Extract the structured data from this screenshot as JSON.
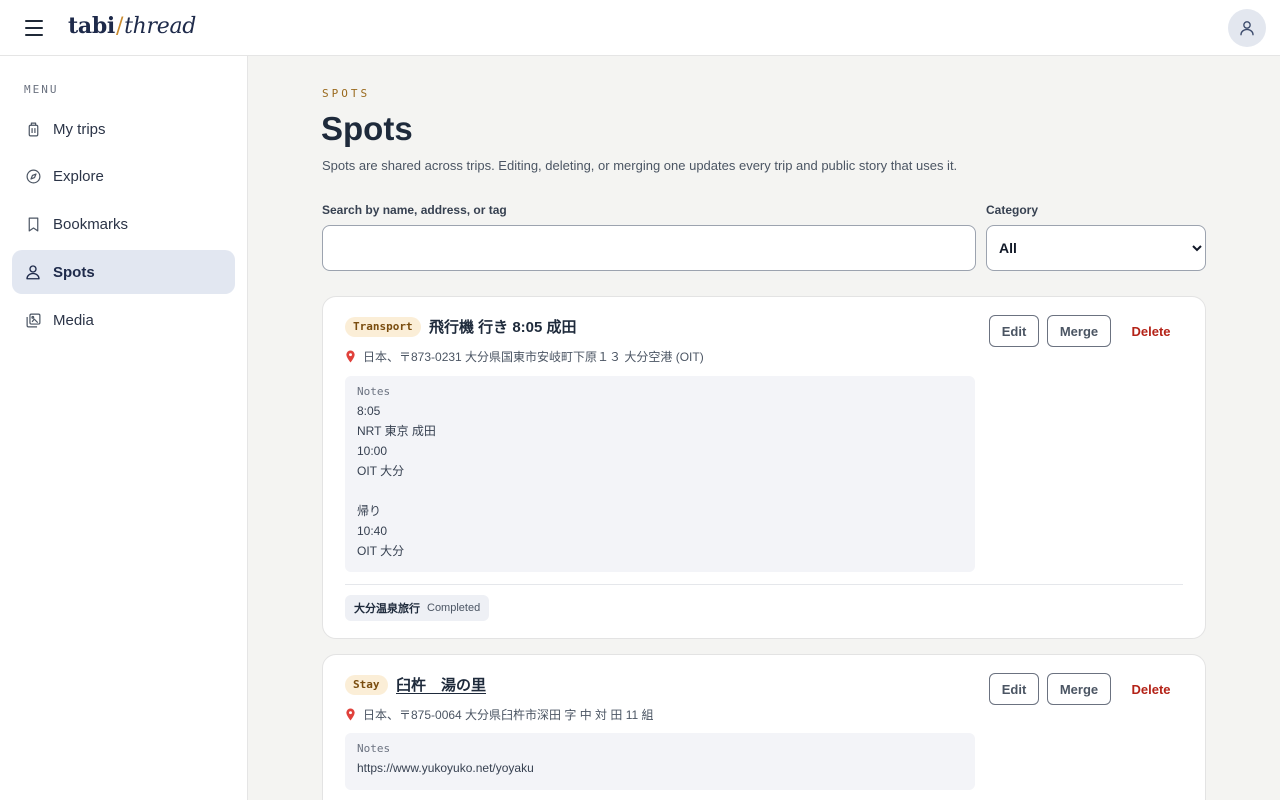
{
  "header": {
    "brand_part1": "tabi",
    "brand_slash": "/",
    "brand_part2": "thread"
  },
  "sidebar": {
    "menu_label": "MENU",
    "items": [
      {
        "label": "My trips",
        "icon": "luggage-icon",
        "active": false
      },
      {
        "label": "Explore",
        "icon": "compass-icon",
        "active": false
      },
      {
        "label": "Bookmarks",
        "icon": "bookmark-icon",
        "active": false
      },
      {
        "label": "Spots",
        "icon": "user-pin-icon",
        "active": true
      },
      {
        "label": "Media",
        "icon": "gallery-icon",
        "active": false
      }
    ]
  },
  "page": {
    "eyebrow": "SPOTS",
    "title": "Spots",
    "description": "Spots are shared across trips. Editing, deleting, or merging one updates every trip and public story that uses it."
  },
  "filters": {
    "search_label": "Search by name, address, or tag",
    "search_value": "",
    "category_label": "Category",
    "category_value": "All"
  },
  "actions": {
    "edit": "Edit",
    "merge": "Merge",
    "delete": "Delete"
  },
  "spots": [
    {
      "category": "Transport",
      "name": "飛行機 行き 8:05 成田",
      "address": "日本、〒873-0231 大分県国東市安岐町下原１３ 大分空港 (OIT)",
      "notes_label": "Notes",
      "notes": "8:05\nNRT 東京 成田\n10:00\nOIT 大分\n\n帰り\n10:40\nOIT 大分",
      "trip_name": "大分温泉旅行",
      "trip_status": "Completed"
    },
    {
      "category": "Stay",
      "name": "臼杵　湯の里",
      "address": "日本、〒875-0064 大分県臼杵市深田 字 中 対 田 11 組",
      "notes_label": "Notes",
      "notes": "https://www.yukoyuko.net/yoyaku"
    }
  ],
  "colors": {
    "accent_navy": "#1e2a4a",
    "accent_gold": "#c98a2e",
    "delete_red": "#b42318",
    "active_nav_bg": "#e2e7f1"
  }
}
